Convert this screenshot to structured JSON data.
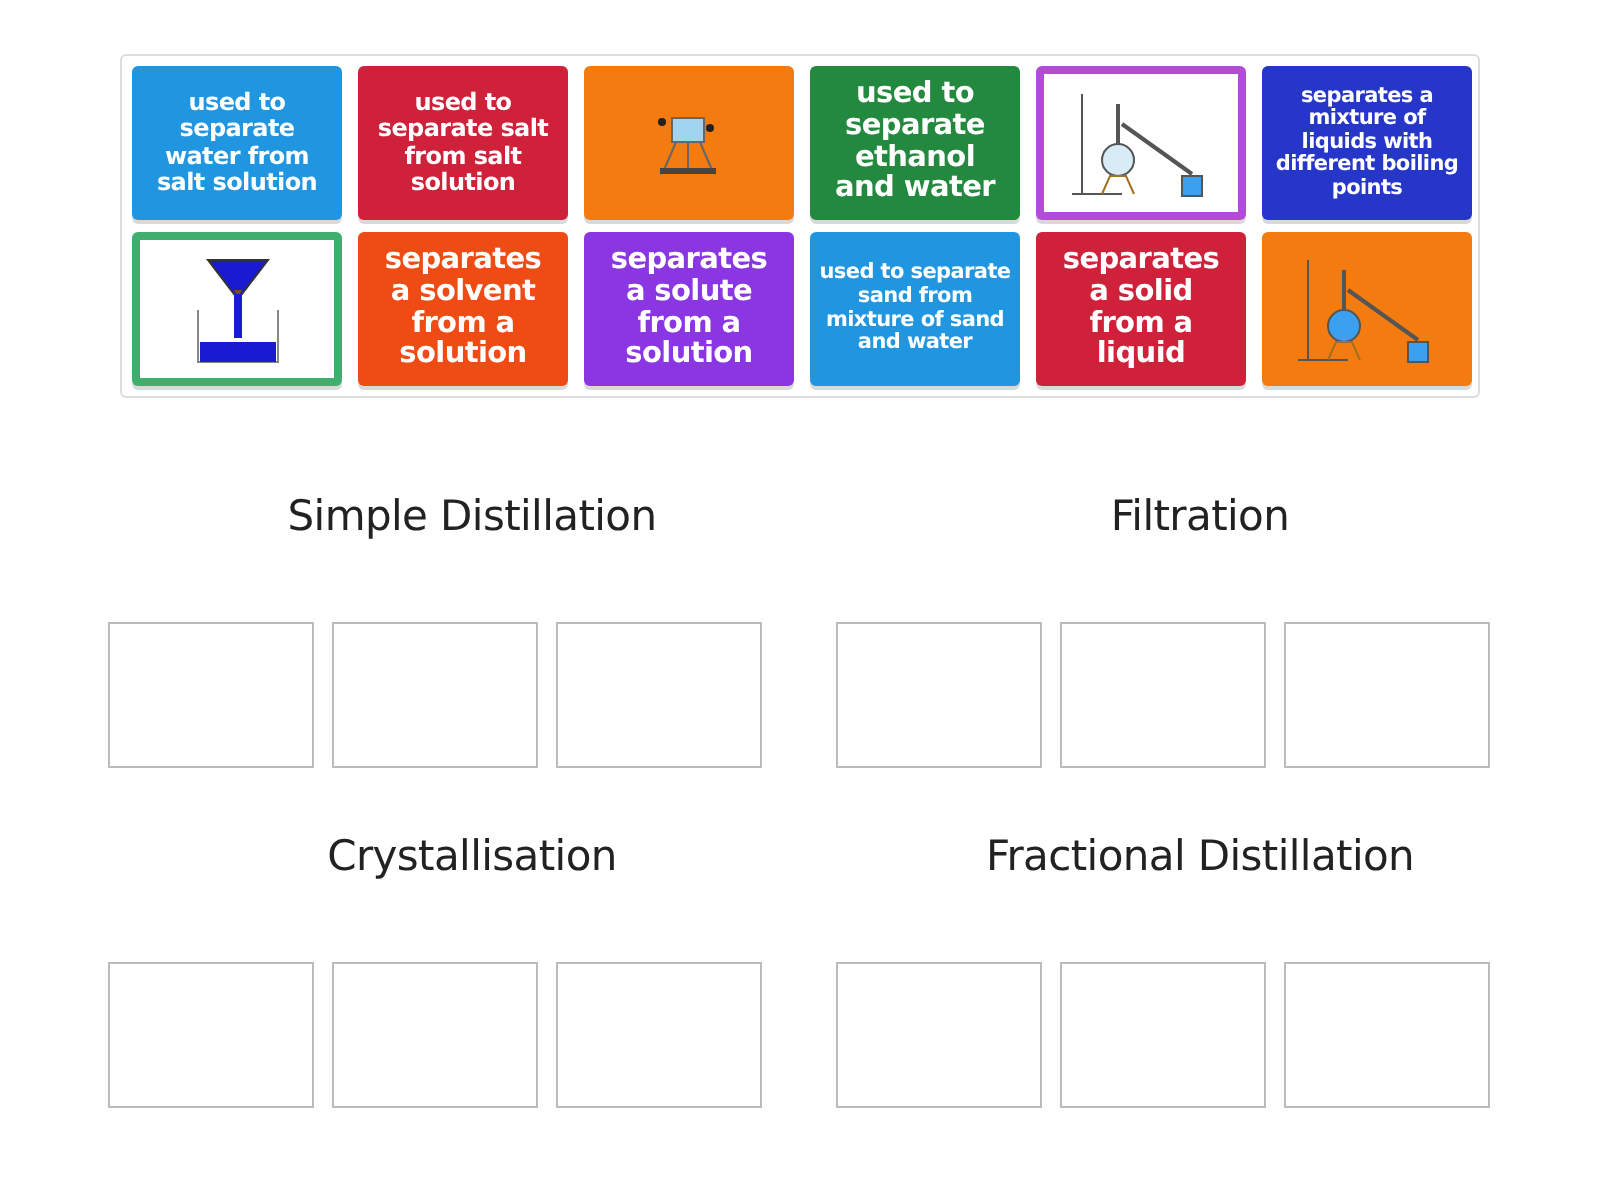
{
  "tiles": [
    {
      "kind": "text",
      "color": "#2196e0",
      "text": "used to separate water from salt solution"
    },
    {
      "kind": "text",
      "color": "#d0213a",
      "text": "used to separate salt from salt solution"
    },
    {
      "kind": "image",
      "color": "#f47b0f"
    },
    {
      "kind": "text",
      "color": "#23893f",
      "text": "used to separate ethanol and water"
    },
    {
      "kind": "image",
      "color": "#b44ad8"
    },
    {
      "kind": "text",
      "color": "#2636c8",
      "text": "separates a mixture of liquids with different boiling points"
    },
    {
      "kind": "image",
      "color": "#3fae6e"
    },
    {
      "kind": "text",
      "color": "#ef4b14",
      "text": "separates a solvent from a solution"
    },
    {
      "kind": "text",
      "color": "#8a36e3",
      "text": "separates a solute from a solution"
    },
    {
      "kind": "text",
      "color": "#2196e0",
      "text": "used to separate sand from mixture of sand and water"
    },
    {
      "kind": "text",
      "color": "#d0213a",
      "text": "separates a solid from a liquid"
    },
    {
      "kind": "image",
      "color": "#f47b0f"
    }
  ],
  "groups": [
    {
      "title": "Simple Distillation"
    },
    {
      "title": "Filtration"
    },
    {
      "title": "Crystallisation"
    },
    {
      "title": "Fractional Distillation"
    }
  ]
}
